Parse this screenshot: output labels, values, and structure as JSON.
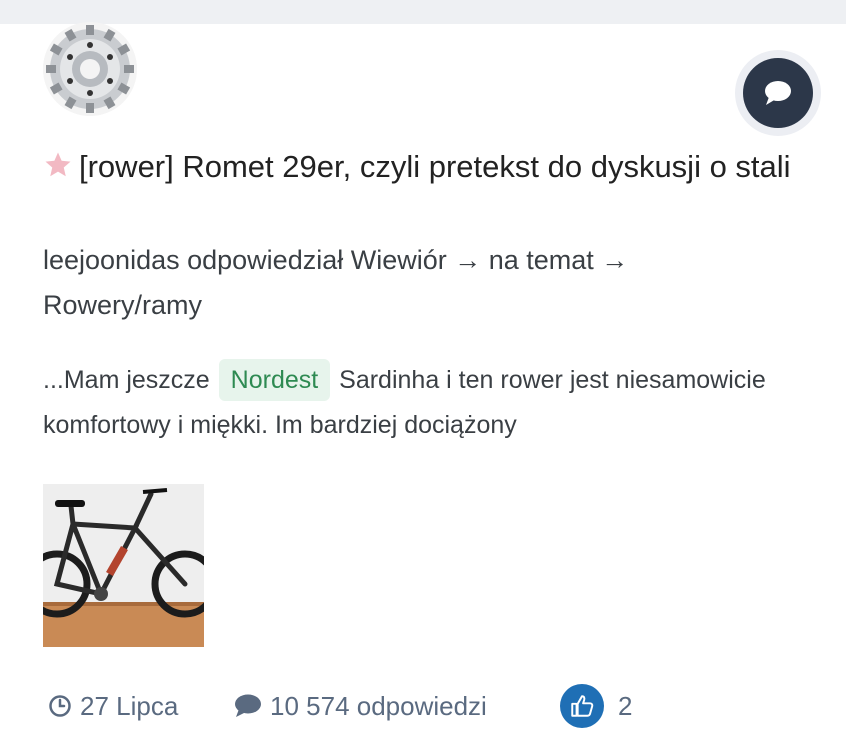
{
  "post": {
    "title": "[rower] Romet 29er, czyli pretekst do dyskusji o stali",
    "meta_line1": "leejoonidas odpowiedział Wiewiór → na temat →",
    "meta_line2": "Rowery/ramy",
    "excerpt_before": "...Mam jeszcze",
    "excerpt_tag": "Nordest",
    "excerpt_after": "Sardinha i ten rower jest niesamowicie komfortowy i miękki. Im bardziej dociążony"
  },
  "footer": {
    "date": "27 Lipca",
    "replies": "10 574 odpowiedzi",
    "likes": "2"
  },
  "icons": {
    "star": "star-icon",
    "reply": "speech-bubble-icon",
    "clock": "clock-icon",
    "comment": "comment-icon",
    "like": "thumbs-up-icon"
  },
  "colors": {
    "star": "#f2b9c3",
    "reply_button": "#2c3749",
    "tag_bg": "#e7f4ec",
    "tag_text": "#2e8a52",
    "like_button": "#1f6fb5",
    "footer_text": "#5a6a80"
  }
}
